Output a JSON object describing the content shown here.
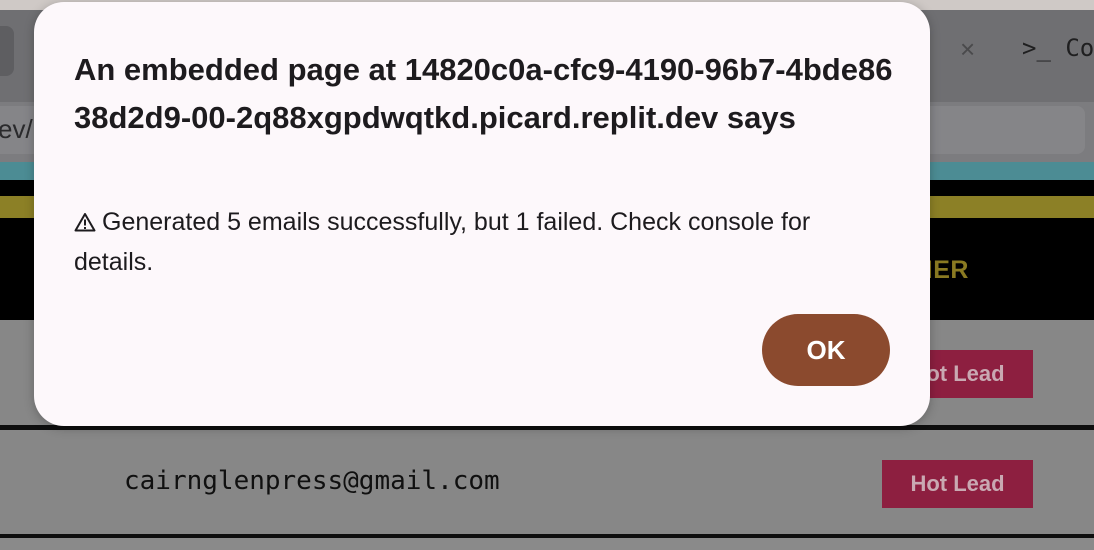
{
  "browser": {
    "address_fragment": "ev/",
    "terminal_label": ">_ Co",
    "close_glyph": "×"
  },
  "table": {
    "header_tier_fragment": "TIER",
    "rows": [
      {
        "email": "",
        "badge": "Hot Lead"
      },
      {
        "email": "cairnglenpress@gmail.com",
        "badge": "Hot Lead"
      }
    ]
  },
  "dialog": {
    "title": "An embedded page at 14820c0a-cfc9-4190-96b7-4bde8638d2d9-00-2q88xgpdwqtkd.picard.replit.dev says",
    "message": "Generated 5 emails successfully, but 1 failed. Check console for details.",
    "icon": "warning-icon",
    "ok_label": "OK",
    "colors": {
      "ok_button": "#8b4a2e",
      "badge": "#8d1f40",
      "dialog_bg": "#fdf8fb"
    }
  }
}
